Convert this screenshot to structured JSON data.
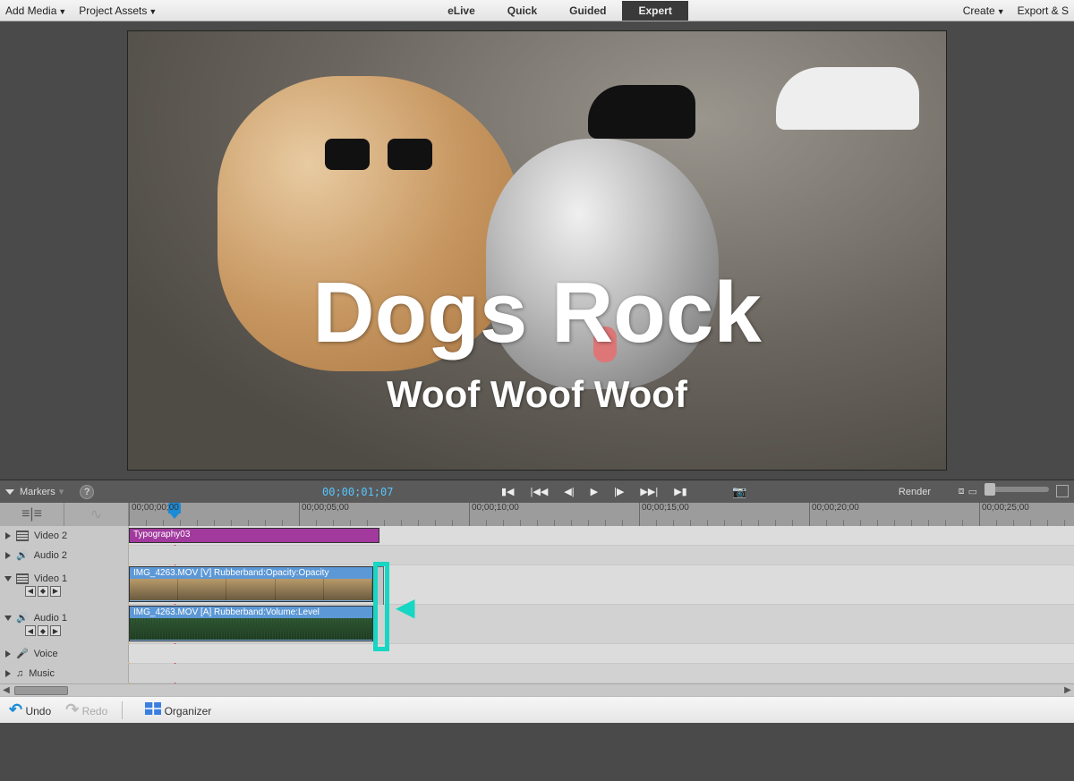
{
  "topbar": {
    "add_media": "Add Media",
    "project_assets": "Project Assets",
    "tabs": {
      "elive": "eLive",
      "quick": "Quick",
      "guided": "Guided",
      "expert": "Expert"
    },
    "active_tab": "expert",
    "create": "Create",
    "export": "Export & S"
  },
  "preview": {
    "overlay_title": "Dogs Rock",
    "overlay_subtitle": "Woof Woof Woof"
  },
  "controlbar": {
    "markers_label": "Markers",
    "timecode": "00;00;01;07",
    "render": "Render"
  },
  "ruler": {
    "ticks": [
      "00;00;00;00",
      "00;00;05;00",
      "00;00;10;00",
      "00;00;15;00",
      "00;00;20;00",
      "00;00;25;00"
    ]
  },
  "tracks": {
    "video2": "Video 2",
    "audio2": "Audio 2",
    "video1": "Video 1",
    "audio1": "Audio 1",
    "voice": "Voice",
    "music": "Music"
  },
  "clips": {
    "typography": "Typography03",
    "video1": "IMG_4263.MOV [V] Rubberband:Opacity:Opacity",
    "audio1": "IMG_4263.MOV [A] Rubberband:Volume:Level"
  },
  "bottombar": {
    "undo": "Undo",
    "redo": "Redo",
    "organizer": "Organizer"
  }
}
